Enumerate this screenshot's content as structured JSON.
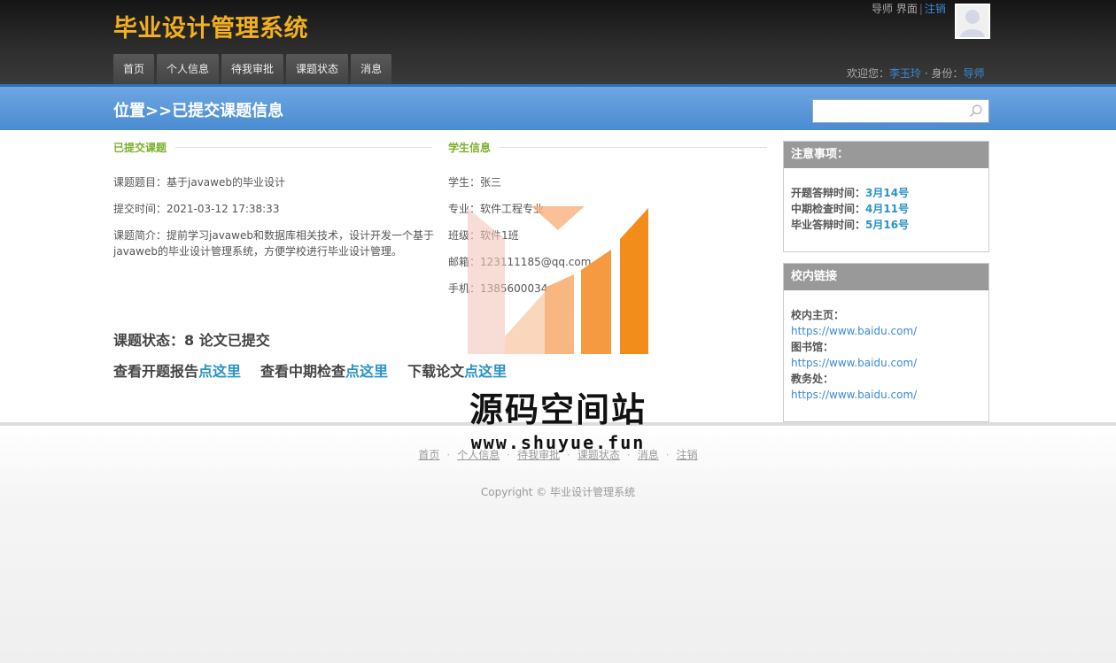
{
  "header": {
    "site_title": "毕业设计管理系统",
    "role_label": "导师 界面",
    "separator": "|",
    "logout": "注销",
    "welcome_prefix": "欢迎您：",
    "user_name": "李玉玲",
    "identity_prefix": " · 身份：",
    "identity": "导师"
  },
  "nav": {
    "items": [
      "首页",
      "个人信息",
      "待我审批",
      "课题状态",
      "消息"
    ]
  },
  "location": {
    "title": "位置>>已提交课题信息",
    "search_placeholder": ""
  },
  "topic": {
    "section_title": "已提交课题",
    "title_line": "课题题目：基于javaweb的毕业设计",
    "submit_time": "提交时间：2021-03-12  17:38:33",
    "intro_line1": "课题简介：提前学习javaweb和数据库相关技术，设计开发一个基于",
    "intro_line2": "javaweb的毕业设计管理系统，方便学校进行毕业设计管理。"
  },
  "student": {
    "section_title": "学生信息",
    "name": "学生：张三",
    "major": "专业：软件工程专业",
    "class": "班级：软件1班",
    "email": "邮箱：123111185@qq.com",
    "phone": "手机：1385600034"
  },
  "status": {
    "text": "课题状态：8 论文已提交"
  },
  "actions": {
    "open_report": "查看开题报告",
    "mid_check": "查看中期检查",
    "download": "下载论文",
    "click_here": "点这里"
  },
  "notice": {
    "title": "注意事项：",
    "items": [
      {
        "label": "开题答辩时间：",
        "value": "3月14号"
      },
      {
        "label": "中期检查时间：",
        "value": "4月11号"
      },
      {
        "label": "毕业答辩时间：",
        "value": "5月16号"
      }
    ]
  },
  "campus_links": {
    "title": "校内链接",
    "items": [
      {
        "label": "校内主页：",
        "url": "https://www.baidu.com/"
      },
      {
        "label": "图书馆：",
        "url": "https://www.baidu.com/"
      },
      {
        "label": "教务处：",
        "url": "https://www.baidu.com/"
      }
    ]
  },
  "footer": {
    "links": [
      "首页",
      "个人信息",
      "待我审批",
      "课题状态",
      "消息",
      "注销"
    ],
    "copyright": "Copyright © 毕业设计管理系统"
  },
  "watermark": {
    "text": "源码空间站",
    "url": "www.shuyue.fun"
  },
  "colors": {
    "title_gold": "#f2b01e",
    "link_blue": "#3a8ad6",
    "section_green": "#7ab02e",
    "value_teal": "#2a93c7",
    "watermark_orange": "#f28c1a"
  }
}
